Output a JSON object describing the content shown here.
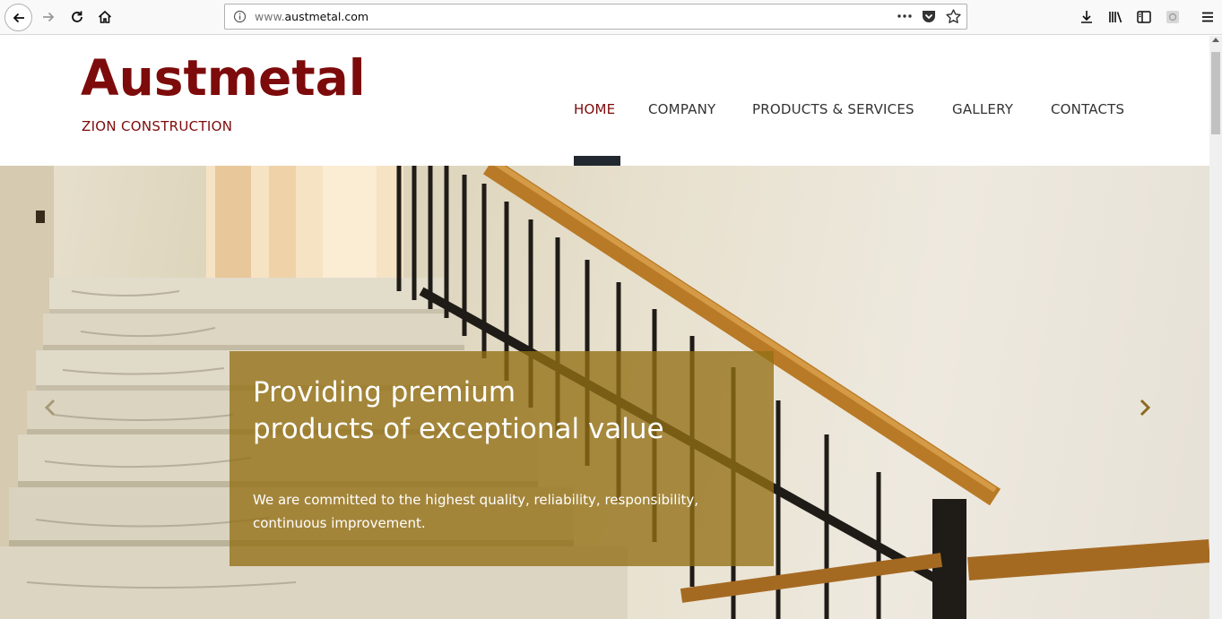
{
  "browser": {
    "url_prefix": "www.",
    "url_domain": "austmetal.com"
  },
  "site": {
    "logo_title": "Austmetal",
    "logo_subtitle": "ZION CONSTRUCTION"
  },
  "nav": {
    "items": [
      {
        "label": "HOME",
        "active": true
      },
      {
        "label": "COMPANY"
      },
      {
        "label": "PRODUCTS & SERVICES"
      },
      {
        "label": "GALLERY"
      },
      {
        "label": "CONTACTS"
      }
    ]
  },
  "hero": {
    "title_line1": "Providing premium",
    "title_line2": "products of exceptional value",
    "text_line1": "We are committed to the highest quality, reliability, responsibility,",
    "text_line2": "continuous improvement.",
    "caption_color": "#94700f",
    "prev_icon": "chevron-left-icon",
    "next_icon": "chevron-right-icon"
  },
  "colors": {
    "brand": "#7d0b0b",
    "nav_marker": "#222830"
  }
}
